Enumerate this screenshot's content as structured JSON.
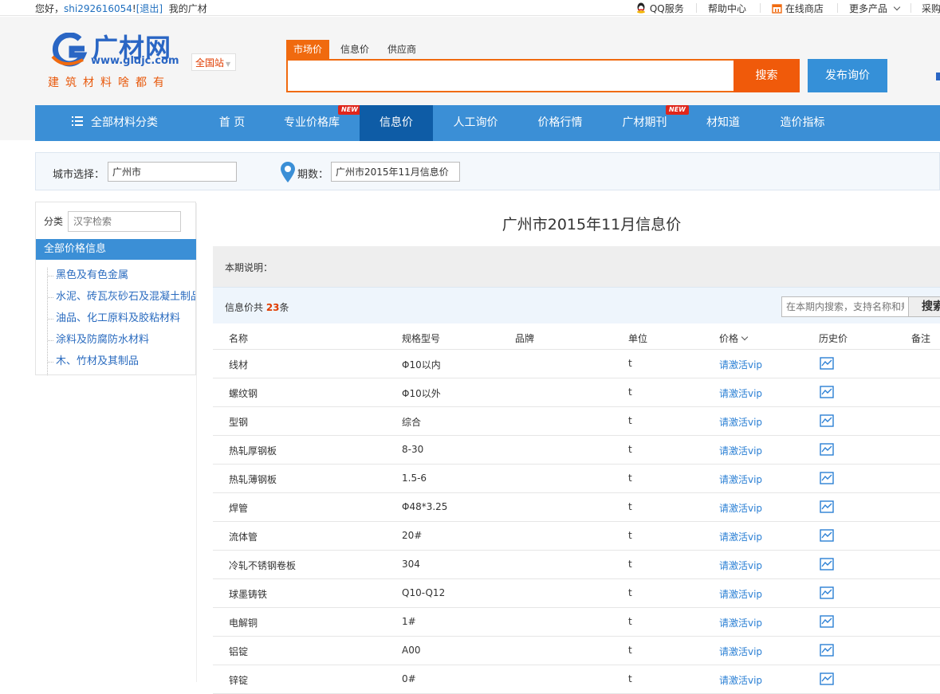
{
  "topbar": {
    "greeting": "您好，",
    "username": "shi292616054",
    "exclaim": "!",
    "logout": "[退出]",
    "my": "我的广材",
    "qq": "QQ服务",
    "help": "帮助中心",
    "store": "在线商店",
    "more": "更多产品",
    "purchase": "采购"
  },
  "logo": {
    "brand": "广材网",
    "url": "www.gldjc.com",
    "slogan": "建筑材料啥都有",
    "station": "全国站"
  },
  "search": {
    "tabs": [
      "市场价",
      "信息价",
      "供应商"
    ],
    "button": "搜索",
    "publish": "发布询价"
  },
  "nav": {
    "all_categories": "全部材料分类",
    "items": [
      "首 页",
      "专业价格库",
      "信息价",
      "人工询价",
      "价格行情",
      "广材期刊",
      "材知道",
      "造价指标"
    ],
    "active": "信息价",
    "new_badge": "NEW"
  },
  "filter": {
    "city_label": "城市选择：",
    "city_value": "广州市",
    "period_label": "期数：",
    "period_value": "广州市2015年11月信息价"
  },
  "sidebar": {
    "category_label": "分类",
    "search_placeholder": "汉字检索",
    "all_label": "全部价格信息",
    "items": [
      "黑色及有色金属",
      "水泥、砖瓦灰砂石及混凝土制品",
      "油品、化工原料及胶粘材料",
      "涂料及防腐防水材料",
      "木、竹材及其制品"
    ]
  },
  "main": {
    "title": "广州市2015年11月信息价",
    "desc_label": "本期说明：",
    "count_prefix": "信息价共 ",
    "count": "23",
    "count_suffix": "条",
    "search_placeholder": "在本期内搜索，支持名称和规格",
    "search_button": "搜索"
  },
  "table": {
    "headers": [
      "名称",
      "规格型号",
      "品牌",
      "单位",
      "价格",
      "历史价",
      "备注"
    ],
    "rows": [
      {
        "name": "线材",
        "spec": "Φ10以内",
        "unit": "t",
        "price": "请激活vip"
      },
      {
        "name": "螺纹钢",
        "spec": "Φ10以外",
        "unit": "t",
        "price": "请激活vip"
      },
      {
        "name": "型钢",
        "spec": "综合",
        "unit": "t",
        "price": "请激活vip"
      },
      {
        "name": "热轧厚钢板",
        "spec": "8-30",
        "unit": "t",
        "price": "请激活vip"
      },
      {
        "name": "热轧薄钢板",
        "spec": "1.5-6",
        "unit": "t",
        "price": "请激活vip"
      },
      {
        "name": "焊管",
        "spec": "Φ48*3.25",
        "unit": "t",
        "price": "请激活vip"
      },
      {
        "name": "流体管",
        "spec": "20#",
        "unit": "t",
        "price": "请激活vip"
      },
      {
        "name": "冷轧不锈钢卷板",
        "spec": "304",
        "unit": "t",
        "price": "请激活vip"
      },
      {
        "name": "球墨铸铁",
        "spec": "Q10-Q12",
        "unit": "t",
        "price": "请激活vip"
      },
      {
        "name": "电解铜",
        "spec": "1#",
        "unit": "t",
        "price": "请激活vip"
      },
      {
        "name": "铝锭",
        "spec": "A00",
        "unit": "t",
        "price": "请激活vip"
      },
      {
        "name": "锌锭",
        "spec": "0#",
        "unit": "t",
        "price": "请激活vip"
      }
    ]
  },
  "colors": {
    "accent_orange": "#f06a0f",
    "nav_blue": "#3b8fd6",
    "nav_active": "#0e5ca6",
    "link_blue": "#2a7fd4",
    "count_red": "#e03c00"
  }
}
